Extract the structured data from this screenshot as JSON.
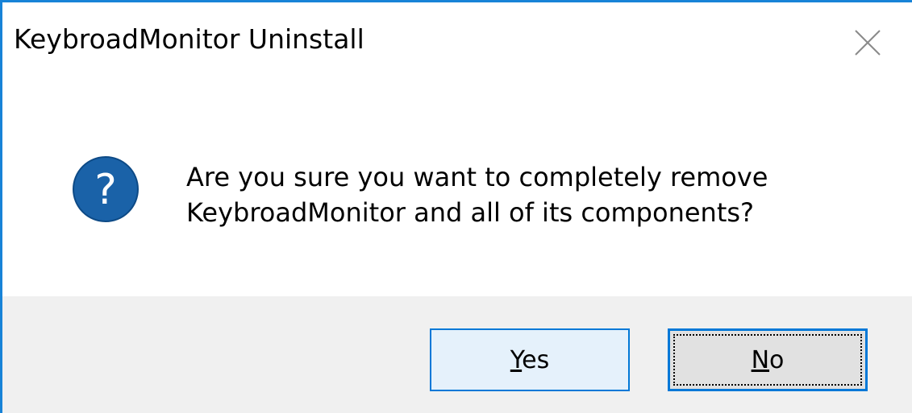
{
  "window": {
    "title": "KeybroadMonitor Uninstall"
  },
  "titlebar": {
    "close_icon": "close-icon"
  },
  "message": {
    "icon": "question-icon",
    "line1": "Are you sure you want to completely remove",
    "line2": "KeybroadMonitor and all of its components?"
  },
  "buttons": {
    "yes": {
      "mnemonic": "Y",
      "rest": "es"
    },
    "no": {
      "mnemonic": "N",
      "rest": "o"
    }
  },
  "colors": {
    "accent": "#0078d7",
    "icon_blue": "#1a62a8",
    "footer_bg": "#f0f0f0"
  }
}
